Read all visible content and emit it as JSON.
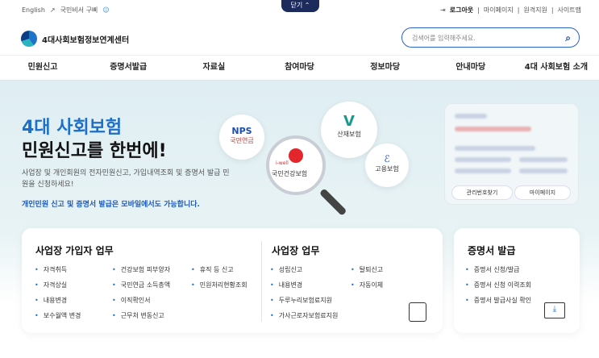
{
  "util": {
    "english": "English",
    "subscribe": "국민비서 구삐",
    "logout": "로그아웃",
    "mypage": "마이페이지",
    "remote": "원격지원",
    "sitemap": "사이트맵"
  },
  "close_tab": "닫기",
  "logo": {
    "name": "4대사회보험정보연계센터"
  },
  "search": {
    "placeholder": "검색어를 입력해주세요."
  },
  "nav": [
    "민원신고",
    "증명서발급",
    "자료실",
    "참여마당",
    "정보마당",
    "안내마당",
    "4대 사회보험 소개"
  ],
  "hero": {
    "title_blue": "4대 사회보험",
    "title_black": "민원신고를 한번에!",
    "desc": "사업장 및 개인회원의 전자민원신고, 가입내역조회 및 증명서 발급 민원을 신청하세요!",
    "notice": "개인민원 신고 및 증명서 발급은 모바일에서도 가능합니다."
  },
  "agencies": {
    "nps": "국민연금",
    "nps_logo": "NPS",
    "kcomwel": "산재보험",
    "nhis": "국민건강보험",
    "nhis_logo": "i-well",
    "ei": "고용보험"
  },
  "login_card": {
    "btn1": "관리번호찾기",
    "btn2": "마이페이지"
  },
  "card1": {
    "title": "사업장 가입자 업무",
    "col1": [
      "자격취득",
      "자격상실",
      "내용변경",
      "보수월액 변경"
    ],
    "col2": [
      "건강보험 피부양자",
      "국민연금 소득총액",
      "이직확인서",
      "근무처 변동신고"
    ],
    "col3": [
      "휴직 등 신고",
      "민원처리현황조회"
    ]
  },
  "card2": {
    "title": "사업장 업무",
    "col1": [
      "성립신고",
      "내용변경",
      "두루누리보험료지원",
      "가사근로자보험료지원"
    ],
    "col2": [
      "탈퇴신고",
      "자동이체"
    ]
  },
  "card3": {
    "title": "증명서 발급",
    "items": [
      "증명서 신청/발급",
      "증명서 신청 이력조회",
      "증명서 발급사실 확인"
    ]
  }
}
